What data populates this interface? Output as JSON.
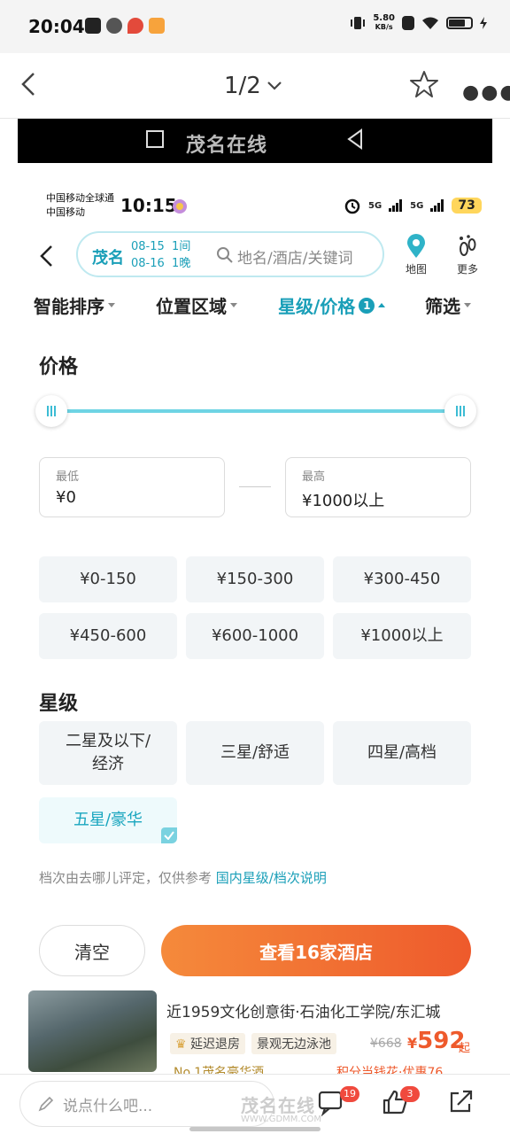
{
  "status_bar": {
    "time": "20:04",
    "net_speed_value": "5.80",
    "net_speed_unit": "KB/s"
  },
  "viewer": {
    "page_indicator": "1/2"
  },
  "inner_status": {
    "carrier_1": "中国移动全球通",
    "carrier_2": "中国移动",
    "time": "10:15",
    "signal_1": "5G",
    "signal_2": "5G",
    "battery": "73"
  },
  "search": {
    "city": "茂名",
    "checkin": "08-15",
    "checkout": "08-16",
    "rooms": "1间",
    "nights": "1晚",
    "placeholder": "地名/酒店/关键词",
    "map_label": "地图",
    "more_label": "更多"
  },
  "filters": {
    "sort": "智能排序",
    "location": "位置区域",
    "star_price": "星级/价格",
    "star_price_count": "1",
    "screen": "筛选"
  },
  "price": {
    "title": "价格",
    "min_label": "最低",
    "min_value": "¥0",
    "max_label": "最高",
    "max_value": "¥1000以上",
    "ranges": [
      "¥0-150",
      "¥150-300",
      "¥300-450",
      "¥450-600",
      "¥600-1000",
      "¥1000以上"
    ]
  },
  "star": {
    "title": "星级",
    "options": [
      "二星及以下/\n经济",
      "三星/舒适",
      "四星/高档",
      "五星/豪华"
    ],
    "selected": "五星/豪华"
  },
  "note": {
    "text": "档次由去哪儿评定，仅供参考",
    "link": "国内星级/档次说明"
  },
  "actions": {
    "clear": "清空",
    "view": "查看16家酒店"
  },
  "hotel": {
    "address": "近1959文化创意街·石油化工学院/东汇城",
    "tag_1": "延迟退房",
    "tag_2": "景观无边泳池",
    "old_price": "¥668",
    "currency": "¥",
    "price": "592",
    "price_suffix": "起",
    "rank": "No.1茂名豪华酒",
    "promo": "积分当钱花·优惠76"
  },
  "bottom": {
    "comment_placeholder": "说点什么吧...",
    "comment_count": "19",
    "like_count": "3",
    "watermark": "茂名在线",
    "watermark_url": "WWW.GDMM.COM"
  },
  "colors": {
    "accent": "#1a9fb8",
    "orange": "#ee5a2c",
    "chip_bg": "#f2f5f7"
  }
}
